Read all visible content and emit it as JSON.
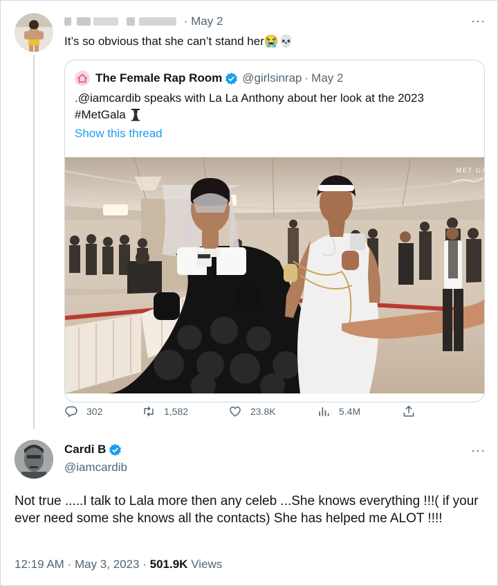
{
  "first_tweet": {
    "date": "May 2",
    "text": "It’s so obvious that she can’t stand her😭💀"
  },
  "quoted_tweet": {
    "name": "The Female Rap Room",
    "handle": "@girlsinrap",
    "date": "May 2",
    "text": ".@iamcardib speaks with La La Anthony about her look at the 2023 #MetGala",
    "link": "Show this thread",
    "video_watermark": "MET GALA"
  },
  "actions": {
    "replies": "302",
    "retweets": "1,582",
    "likes": "23.8K",
    "views": "5.4M"
  },
  "reply_tweet": {
    "name": "Cardi B",
    "handle": "@iamcardib",
    "text": "Not true .....I talk to Lala more then any celeb ...She knows everything !!!( if your ever need some she knows all the contacts) She has helped me ALOT !!!!",
    "time": "12:19 AM",
    "date": "May 3, 2023",
    "views_count": "501.9K",
    "views_label": "Views"
  },
  "colors": {
    "accent": "#1d9bf0",
    "secondary_text": "#536471",
    "border": "#cfd9de"
  }
}
